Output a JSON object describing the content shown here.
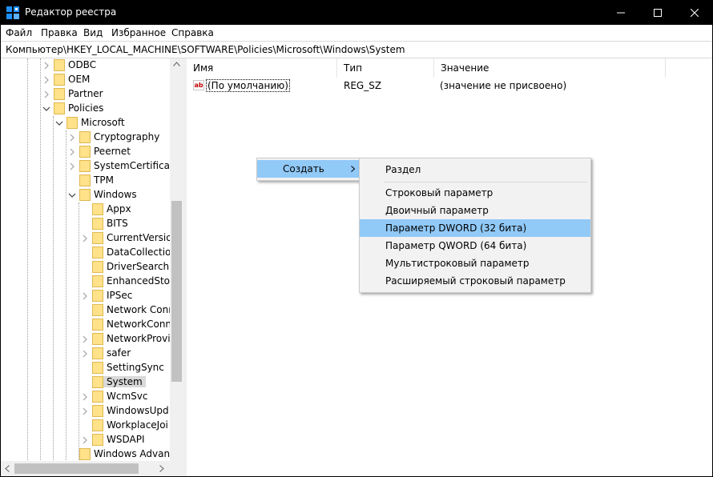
{
  "window": {
    "title": "Редактор реестра",
    "icons": [
      "registry-editor-icon",
      "minimize-icon",
      "maximize-icon",
      "close-icon"
    ]
  },
  "menubar": {
    "items": [
      {
        "label": "Файл"
      },
      {
        "label": "Правка"
      },
      {
        "label": "Вид"
      },
      {
        "label": "Избранное"
      },
      {
        "label": "Справка"
      }
    ]
  },
  "address": {
    "path": "Компьютер\\HKEY_LOCAL_MACHINE\\SOFTWARE\\Policies\\Microsoft\\Windows\\System"
  },
  "tree": {
    "items": [
      {
        "label": "ODBC",
        "expander": "collapsed"
      },
      {
        "label": "OEM",
        "expander": "collapsed"
      },
      {
        "label": "Partner",
        "expander": "collapsed"
      },
      {
        "label": "Policies",
        "expander": "expanded"
      },
      {
        "label": "Microsoft",
        "expander": "expanded"
      },
      {
        "label": "Cryptography",
        "expander": "collapsed"
      },
      {
        "label": "Peernet",
        "expander": "collapsed"
      },
      {
        "label": "SystemCertificate",
        "expander": "collapsed"
      },
      {
        "label": "TPM",
        "expander": "none"
      },
      {
        "label": "Windows",
        "expander": "expanded"
      },
      {
        "label": "Appx",
        "expander": "none"
      },
      {
        "label": "BITS",
        "expander": "none"
      },
      {
        "label": "CurrentVersio",
        "expander": "collapsed"
      },
      {
        "label": "DataCollectio",
        "expander": "none"
      },
      {
        "label": "DriverSearchin",
        "expander": "none"
      },
      {
        "label": "EnhancedStor",
        "expander": "none"
      },
      {
        "label": "IPSec",
        "expander": "collapsed"
      },
      {
        "label": "Network Conn",
        "expander": "none"
      },
      {
        "label": "NetworkConn",
        "expander": "none"
      },
      {
        "label": "NetworkProvi",
        "expander": "collapsed"
      },
      {
        "label": "safer",
        "expander": "collapsed"
      },
      {
        "label": "SettingSync",
        "expander": "none"
      },
      {
        "label": "System",
        "expander": "none",
        "selected": true
      },
      {
        "label": "WcmSvc",
        "expander": "collapsed"
      },
      {
        "label": "WindowsUpd",
        "expander": "collapsed"
      },
      {
        "label": "WorkplaceJoi",
        "expander": "none"
      },
      {
        "label": "WSDAPI",
        "expander": "collapsed"
      },
      {
        "label": "Windows Advanc",
        "expander": "none"
      }
    ]
  },
  "list": {
    "columns": [
      {
        "label": "Имя"
      },
      {
        "label": "Тип"
      },
      {
        "label": "Значение"
      }
    ],
    "rows": [
      {
        "name": "(По умолчанию)",
        "type": "REG_SZ",
        "value": "(значение не присвоено)",
        "icon": "string-value-icon"
      }
    ]
  },
  "context_menu": {
    "new_label": "Создать",
    "submenu": [
      {
        "label": "Раздел"
      },
      {
        "label": "Строковый параметр"
      },
      {
        "label": "Двоичный параметр"
      },
      {
        "label": "Параметр DWORD (32 бита)",
        "highlighted": true
      },
      {
        "label": "Параметр QWORD (64 бита)"
      },
      {
        "label": "Мультистроковый параметр"
      },
      {
        "label": "Расширяемый строковый параметр"
      }
    ]
  },
  "colors": {
    "titlebar": "#000000",
    "highlight": "#91c9f7",
    "folder": "#ffe28a",
    "selection": "#d9d9d9"
  }
}
